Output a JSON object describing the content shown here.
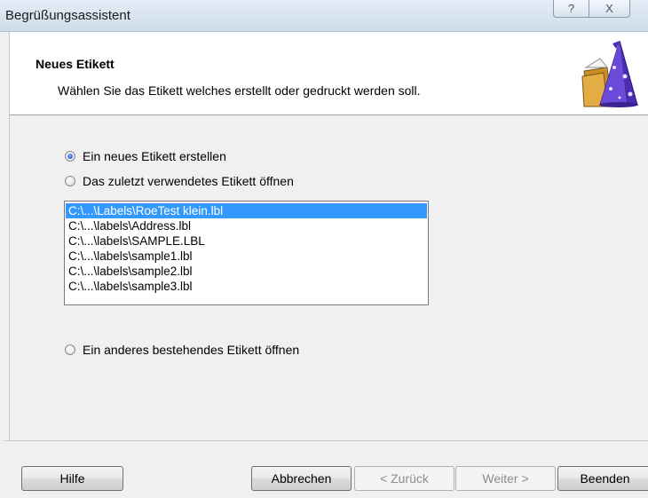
{
  "window": {
    "title": "Begrüßungsassistent",
    "help_glyph": "?",
    "close_glyph": "X"
  },
  "header": {
    "title": "Neues Etikett",
    "description": "Wählen Sie das Etikett welches erstellt oder gedruckt werden soll."
  },
  "options": {
    "new_label": "Ein neues Etikett erstellen",
    "recent_label": "Das zuletzt verwendetes Etikett öffnen",
    "other_label": "Ein anderes bestehendes Etikett öffnen",
    "selected": "new_label"
  },
  "recent_files": [
    "C:\\...\\Labels\\RoeTest klein.lbl",
    "C:\\...\\labels\\Address.lbl",
    "C:\\...\\labels\\SAMPLE.LBL",
    "C:\\...\\labels\\sample1.lbl",
    "C:\\...\\labels\\sample2.lbl",
    "C:\\...\\labels\\sample3.lbl"
  ],
  "selected_file_index": 0,
  "buttons": {
    "help": "Hilfe",
    "cancel": "Abbrechen",
    "back": "< Zurück",
    "next": "Weiter >",
    "finish": "Beenden"
  },
  "colors": {
    "selection": "#3399ff",
    "header_bg": "#ffffff",
    "dialog_bg": "#f0f0f0"
  }
}
